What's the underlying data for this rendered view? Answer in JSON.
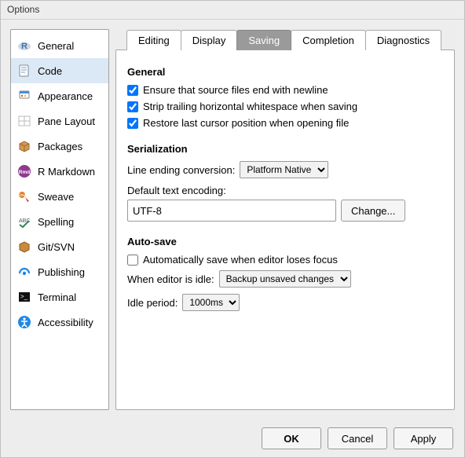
{
  "window": {
    "title": "Options"
  },
  "sidebar": {
    "items": [
      {
        "label": "General"
      },
      {
        "label": "Code"
      },
      {
        "label": "Appearance"
      },
      {
        "label": "Pane Layout"
      },
      {
        "label": "Packages"
      },
      {
        "label": "R Markdown"
      },
      {
        "label": "Sweave"
      },
      {
        "label": "Spelling"
      },
      {
        "label": "Git/SVN"
      },
      {
        "label": "Publishing"
      },
      {
        "label": "Terminal"
      },
      {
        "label": "Accessibility"
      }
    ]
  },
  "tabs": {
    "items": [
      {
        "label": "Editing"
      },
      {
        "label": "Display"
      },
      {
        "label": "Saving"
      },
      {
        "label": "Completion"
      },
      {
        "label": "Diagnostics"
      }
    ]
  },
  "sections": {
    "general": {
      "title": "General",
      "checks": [
        {
          "label": "Ensure that source files end with newline"
        },
        {
          "label": "Strip trailing horizontal whitespace when saving"
        },
        {
          "label": "Restore last cursor position when opening file"
        }
      ]
    },
    "serialization": {
      "title": "Serialization",
      "line_ending_label": "Line ending conversion:",
      "line_ending_value": "Platform Native",
      "encoding_label": "Default text encoding:",
      "encoding_value": "UTF-8",
      "change_btn": "Change..."
    },
    "autosave": {
      "title": "Auto-save",
      "check_label": "Automatically save when editor loses focus",
      "idle_action_label": "When editor is idle:",
      "idle_action_value": "Backup unsaved changes",
      "idle_period_label": "Idle period:",
      "idle_period_value": "1000ms"
    }
  },
  "footer": {
    "ok": "OK",
    "cancel": "Cancel",
    "apply": "Apply"
  }
}
